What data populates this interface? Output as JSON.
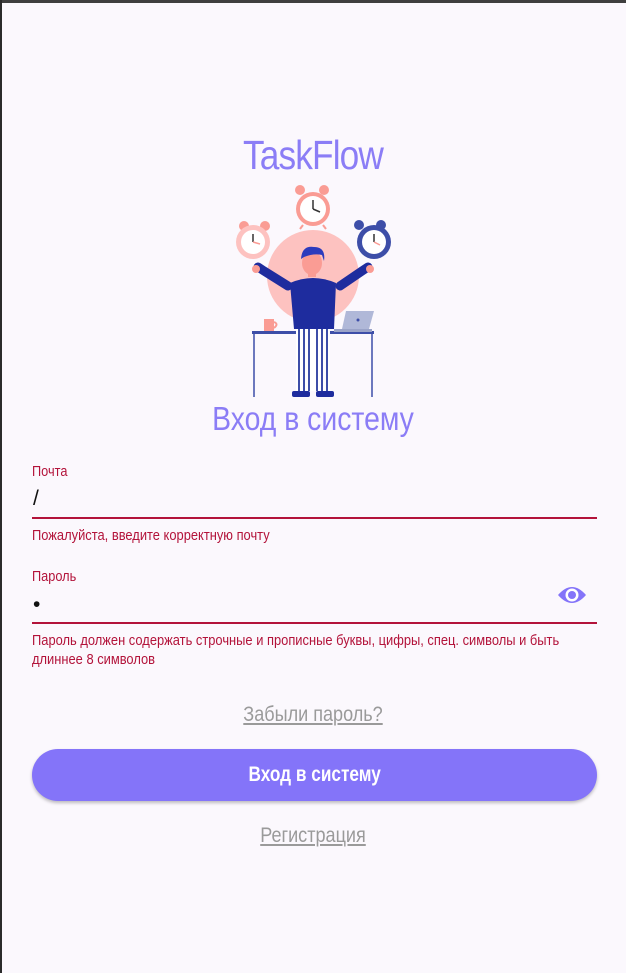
{
  "app": {
    "title": "TaskFlow"
  },
  "screen": {
    "title": "Вход в систему"
  },
  "email": {
    "label": "Почта",
    "value": "/",
    "error": "Пожалуйста, введите корректную почту"
  },
  "password": {
    "label": "Пароль",
    "value": "•",
    "error_line1": "Пароль должен содержать строчные и прописные буквы, цифры, спец. символы и быть",
    "error_line2": "длиннее 8 символов",
    "toggle_icon": "eye-icon"
  },
  "actions": {
    "forgot_password": "Забыли пароль?",
    "login_button": "Вход в систему",
    "register_link": "Регистрация"
  },
  "colors": {
    "accent": "#8474f9",
    "title": "#8b7df6",
    "error": "#b3133a",
    "link": "#9a9a9a",
    "background": "#fbf8fd"
  }
}
